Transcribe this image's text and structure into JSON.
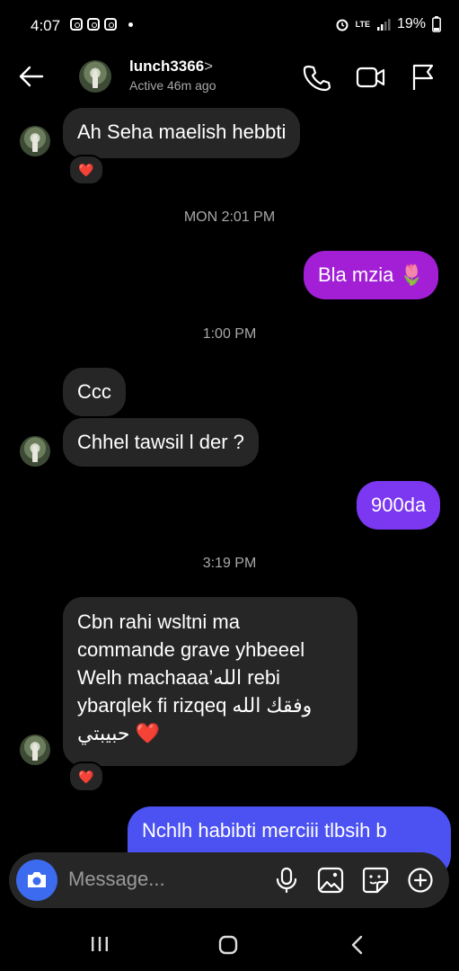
{
  "status_bar": {
    "time": "4:07",
    "network": "LTE",
    "battery": "19%"
  },
  "header": {
    "username": "lunch3366",
    "chevron": ">",
    "active_status": "Active 46m ago"
  },
  "messages": [
    {
      "id": "m1",
      "direction": "in",
      "text": "Ah Seha maelish hebbti",
      "reaction": "❤️"
    },
    {
      "id": "t1",
      "type": "timestamp",
      "text": "MON 2:01 PM"
    },
    {
      "id": "m2",
      "direction": "out",
      "text": "Bla mzia 🌷"
    },
    {
      "id": "t2",
      "type": "timestamp",
      "text": "1:00 PM"
    },
    {
      "id": "m3",
      "direction": "in",
      "text": "Ccc"
    },
    {
      "id": "m4",
      "direction": "in",
      "text": "Chhel tawsil l der ?"
    },
    {
      "id": "m5",
      "direction": "out",
      "text": "900da"
    },
    {
      "id": "t3",
      "type": "timestamp",
      "text": "3:19 PM"
    },
    {
      "id": "m6",
      "direction": "in",
      "lines": [
        "Cbn rahi wsltni ma",
        "commande grave yhbeeel",
        "Welh machaaa’الله rebi",
        "ybarqlek fi rizqeq وفقك الله",
        "حبيبتي ❤️"
      ],
      "reaction": "❤️"
    },
    {
      "id": "m7",
      "direction": "out",
      "text": "Nchlh habibti merciii tlbsih b"
    }
  ],
  "composer": {
    "placeholder": "Message..."
  },
  "colors": {
    "background": "#000000",
    "incoming_bubble": "#262626",
    "outgoing_purple": "#a21fd6",
    "outgoing_violet": "#7b38f0",
    "outgoing_blue": "#4c52f2",
    "camera_button": "#3d6bf0",
    "reaction_heart": "#ef2b45"
  },
  "icons": {
    "back": "arrow-left-icon",
    "call": "phone-icon",
    "video": "video-camera-icon",
    "report": "flag-icon",
    "camera": "camera-icon",
    "mic": "microphone-icon",
    "gallery": "image-icon",
    "sticker": "sticker-icon",
    "more": "plus-circle-icon"
  }
}
